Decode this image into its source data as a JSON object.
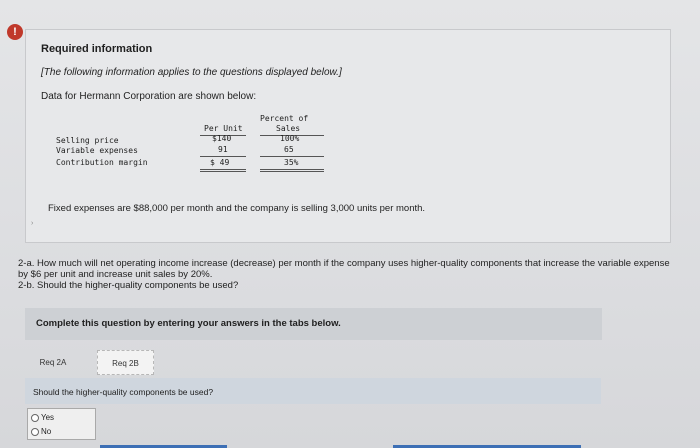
{
  "alert": {
    "glyph": "!"
  },
  "info": {
    "title": "Required information",
    "note": "[The following information applies to the questions displayed below.]",
    "intro": "Data for Hermann Corporation are shown below:",
    "table": {
      "header_per_unit": "Per Unit",
      "header_percent_1": "Percent of",
      "header_percent_2": "Sales",
      "rows": [
        {
          "label": "Selling price",
          "per_unit": "$140",
          "percent": "100%"
        },
        {
          "label": "Variable expenses",
          "per_unit": "91",
          "percent": "65"
        },
        {
          "label": "Contribution margin",
          "per_unit": "$ 49",
          "percent": "35%"
        }
      ]
    },
    "fixed_expenses": "Fixed expenses are $88,000 per month and the company is selling 3,000 units per month.",
    "corner_mark": "›"
  },
  "question": {
    "line_2a": "2-a. How much will net operating income increase (decrease) per month if the company uses higher-quality components that increase the variable expense by $6 per unit and increase unit sales by 20%.",
    "line_2b": "2-b. Should the higher-quality components be used?"
  },
  "complete_bar": "Complete this question by entering your answers in the tabs below.",
  "tabs": [
    {
      "label": "Req 2A"
    },
    {
      "label": "Req 2B"
    }
  ],
  "prompt": "Should the higher-quality components be used?",
  "options": [
    {
      "label": "Yes"
    },
    {
      "label": "No"
    }
  ]
}
